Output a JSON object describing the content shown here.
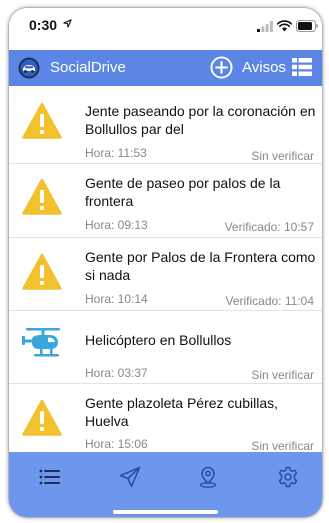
{
  "status_bar": {
    "time": "0:30"
  },
  "header": {
    "app_title": "SocialDrive",
    "avisos_label": "Avisos"
  },
  "alerts": [
    {
      "title": "Jente paseando por la coronación en Bollullos par del",
      "time": "Hora: 11:53",
      "status": "Sin verificar",
      "icon": "warning-icon"
    },
    {
      "title": "Gente de paseo por palos de la frontera",
      "time": "Hora: 09:13",
      "status": "Verificado: 10:57",
      "icon": "warning-icon"
    },
    {
      "title": "Gente por Palos de la Frontera como si nada",
      "time": "Hora: 10:14",
      "status": "Verificado: 11:04",
      "icon": "warning-icon"
    },
    {
      "title": "Helicóptero en Bollullos",
      "time": "Hora: 03:37",
      "status": "Sin verificar",
      "icon": "helicopter-icon"
    },
    {
      "title": "Gente plazoleta Pérez cubillas, Huelva",
      "time": "Hora: 15:06",
      "status": "Sin verificar",
      "icon": "warning-icon"
    }
  ],
  "tabs": [
    {
      "name": "list-tab",
      "icon": "list-icon"
    },
    {
      "name": "send-tab",
      "icon": "paper-plane-icon"
    },
    {
      "name": "map-tab",
      "icon": "map-pin-icon"
    },
    {
      "name": "settings-tab",
      "icon": "gear-icon"
    }
  ],
  "colors": {
    "header": "#5b86e5",
    "tab_bar": "#6c97ec",
    "warning": "#f2c12e",
    "helicopter": "#3aa6dc"
  }
}
